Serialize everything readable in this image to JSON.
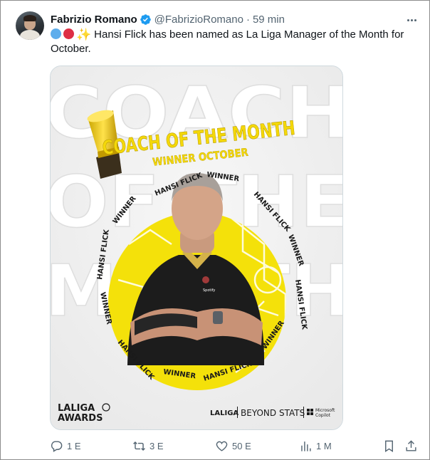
{
  "tweet": {
    "author_name": "Fabrizio Romano",
    "handle": "@FabrizioRomano",
    "separator": "·",
    "time": "59 min",
    "text": "Hansi Flick has been named as La Liga Manager of the Month for October."
  },
  "media": {
    "bg_title_top": "COACH",
    "bg_title_mid": "OF THE",
    "bg_title_bottom": "MONTH",
    "headline": "COACH OF THE MONTH",
    "subheadline": "WINNER OCTOBER",
    "ring_name": "HANSI FLICK",
    "ring_winner": "WINNER",
    "logo_line1": "LALIGA",
    "logo_line2": "AWARDS",
    "footer_laliga": "LALIGA",
    "footer_beyond": "BEYOND STATS",
    "footer_ms1": "Microsoft",
    "footer_ms2": "Copilot",
    "colors": {
      "yellow": "#f4e10a",
      "accent": "#f0c419",
      "text_dark": "#1a1a1a"
    }
  },
  "actions": {
    "reply_count": "1 E",
    "retweet_count": "3 E",
    "like_count": "50 E",
    "views_count": "1 M"
  },
  "icons": [
    "verified-badge-icon",
    "more-icon",
    "reply-icon",
    "retweet-icon",
    "like-icon",
    "views-icon",
    "bookmark-icon",
    "share-icon"
  ]
}
